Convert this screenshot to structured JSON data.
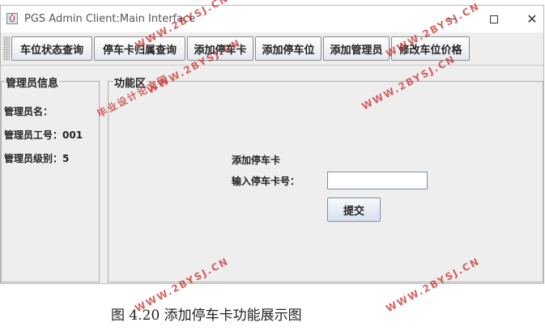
{
  "window": {
    "title": "PGS Admin Client:Main Interface"
  },
  "toolbar": {
    "items": [
      {
        "label": "车位状态查询"
      },
      {
        "label": "停车卡归属查询"
      },
      {
        "label": "添加停车卡"
      },
      {
        "label": "添加停车位"
      },
      {
        "label": "添加管理员"
      },
      {
        "label": "修改车位价格"
      }
    ]
  },
  "admin_panel": {
    "legend": "管理员信息",
    "name_label": "管理员名：",
    "id_label": "管理员工号：",
    "id_value": "001",
    "level_label": "管理员级别：",
    "level_value": "5"
  },
  "function_panel": {
    "legend": "功能区",
    "form_title": "添加停车卡",
    "card_label": "输入停车卡号：",
    "card_value": "",
    "submit_label": "提交"
  },
  "caption": "图 4.20 添加停车卡功能展示图",
  "watermarks": [
    {
      "text": "WWW.2BYSJ.CN"
    },
    {
      "text": "WWW.2BYSJ.CN"
    },
    {
      "text": "WWW.2BYSJ.CN"
    },
    {
      "text": "毕业设计论文网"
    },
    {
      "text": "WWW.2BYSJ.CN"
    },
    {
      "text": "WWW.2BYSJ.CN"
    },
    {
      "text": "WWW.2BYSJ.CN"
    }
  ]
}
